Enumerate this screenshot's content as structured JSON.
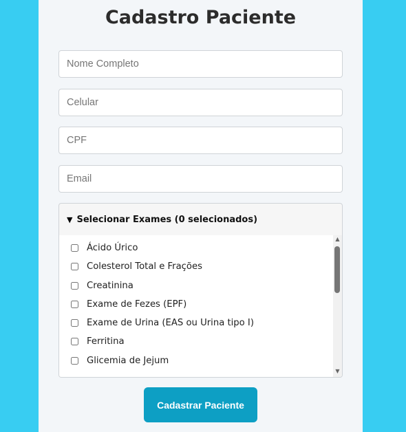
{
  "form": {
    "title": "Cadastro Paciente",
    "fields": [
      {
        "name": "nome",
        "placeholder": "Nome Completo",
        "value": ""
      },
      {
        "name": "celular",
        "placeholder": "Celular",
        "value": ""
      },
      {
        "name": "cpf",
        "placeholder": "CPF",
        "value": ""
      },
      {
        "name": "email",
        "placeholder": "Email",
        "value": ""
      }
    ],
    "exams": {
      "summary_label": "Selecionar Exames (0 selecionados)",
      "expanded": true,
      "items": [
        {
          "label": "Ácido Úrico",
          "checked": false
        },
        {
          "label": "Colesterol Total e Frações",
          "checked": false
        },
        {
          "label": "Creatinina",
          "checked": false
        },
        {
          "label": "Exame de Fezes (EPF)",
          "checked": false
        },
        {
          "label": "Exame de Urina (EAS ou Urina tipo I)",
          "checked": false
        },
        {
          "label": "Ferritina",
          "checked": false
        },
        {
          "label": "Glicemia de Jejum",
          "checked": false
        }
      ]
    },
    "submit_label": "Cadastrar Paciente"
  },
  "icons": {
    "expand": "triangle-down-icon",
    "scroll_up": "arrow-up-icon",
    "scroll_down": "arrow-down-icon"
  },
  "colors": {
    "background": "#38cdf2",
    "card": "#f3f6f9",
    "button": "#0d9fc4",
    "button_text": "#ffffff"
  }
}
